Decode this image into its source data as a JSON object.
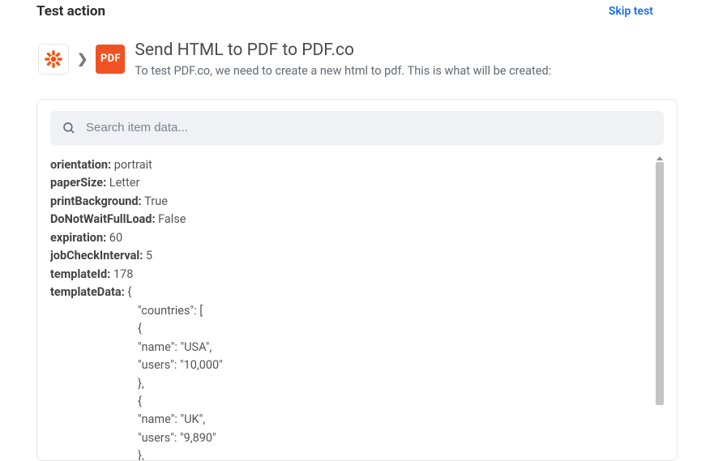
{
  "header": {
    "title": "Test action",
    "skip_label": "Skip test"
  },
  "breadcrumb": {
    "source_icon_name": "zapier-icon",
    "target_icon_name": "pdfco-icon",
    "target_icon_text": "PDF",
    "action_title": "Send HTML to PDF to PDF.co",
    "action_subtitle": "To test PDF.co, we need to create a new html to pdf. This is what will be created:"
  },
  "search": {
    "placeholder": "Search item data..."
  },
  "item_data": {
    "fields": [
      {
        "key": "orientation",
        "value": "portrait"
      },
      {
        "key": "paperSize",
        "value": "Letter"
      },
      {
        "key": "printBackground",
        "value": "True"
      },
      {
        "key": "DoNotWaitFullLoad",
        "value": "False"
      },
      {
        "key": "expiration",
        "value": "60"
      },
      {
        "key": "jobCheckInterval",
        "value": "5"
      },
      {
        "key": "templateId",
        "value": "178"
      }
    ],
    "templateData_key": "templateData",
    "templateData_lines": [
      "{",
      "\"countries\": [",
      "{",
      "\"name\": \"USA\",",
      "\"users\": \"10,000\"",
      "},",
      "{",
      "\"name\": \"UK\",",
      "\"users\": \"9,890\"",
      "},"
    ]
  },
  "colors": {
    "brand_zapier": "#ff4a00",
    "brand_pdfco": "#f05323",
    "link_blue": "#136bf5"
  }
}
